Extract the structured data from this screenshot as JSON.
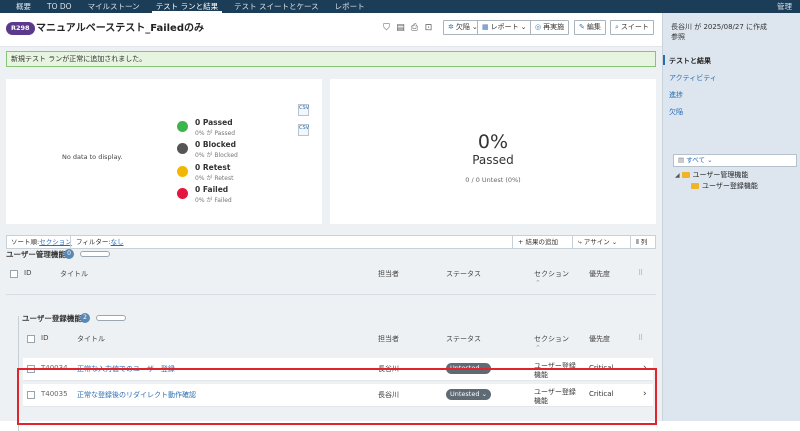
{
  "nav": {
    "tabs": [
      "概要",
      "TO DO",
      "マイルストーン",
      "テスト ランと結果",
      "テスト スイートとケース",
      "レポート"
    ],
    "admin": "管理"
  },
  "run": {
    "badge": "R298",
    "title": "マニュアルベーステスト_Failedのみ"
  },
  "toolbar": {
    "defects": "欠陥",
    "reports": "レポート",
    "rerun": "再実施",
    "edit": "編集",
    "suite": "スイート"
  },
  "notice": "新規テスト ランが正常に追加されました。",
  "summary": {
    "no_data": "No data to display.",
    "stats": [
      {
        "count": "0 Passed",
        "pct": "0% が Passed",
        "color": "#3cb54a"
      },
      {
        "count": "0 Blocked",
        "pct": "0% が Blocked",
        "color": "#555555"
      },
      {
        "count": "0 Retest",
        "pct": "0% が Retest",
        "color": "#f2b705"
      },
      {
        "count": "0 Failed",
        "pct": "0% が Failed",
        "color": "#e3173e"
      }
    ],
    "big_pct": "0%",
    "big_label": "Passed",
    "big_sub": "0 / 0 Untest (0%)",
    "export_labels": [
      "CSV",
      "CSV"
    ]
  },
  "filterbar": {
    "sort_label": "ソート順:",
    "sort_value": "セクション",
    "filter_label": "フィルター:",
    "filter_value": "なし",
    "add_result": "結果の追加",
    "assign": "アサイン",
    "columns": "列"
  },
  "section1": {
    "title": "ユーザー管理機能",
    "count": "0"
  },
  "section2": {
    "title": "ユーザー登録機能",
    "count": "2"
  },
  "columns": {
    "id": "ID",
    "title": "タイトル",
    "assignee": "担当者",
    "status": "ステータス",
    "section": "セクション",
    "priority": "優先度"
  },
  "rows": [
    {
      "id": "T40034",
      "title": "正常な入力値でのユーザー登録",
      "assignee": "長谷川",
      "status": "Untested",
      "section1": "ユーザー登録",
      "section2": "機能",
      "priority": "Critical"
    },
    {
      "id": "T40035",
      "title": "正常な登録後のリダイレクト動作確認",
      "assignee": "長谷川",
      "status": "Untested",
      "section1": "ユーザー登録",
      "section2": "機能",
      "priority": "Critical"
    }
  ],
  "sidebar": {
    "created_line1": "長谷川 が 2025/08/27 に作成",
    "created_line2": "参照",
    "items": [
      "テストと結果",
      "アクティビティ",
      "進捗",
      "欠陥"
    ],
    "tree_filter": "すべて",
    "tree": [
      "ユーザー管理機能",
      "ユーザー登録機能"
    ]
  }
}
